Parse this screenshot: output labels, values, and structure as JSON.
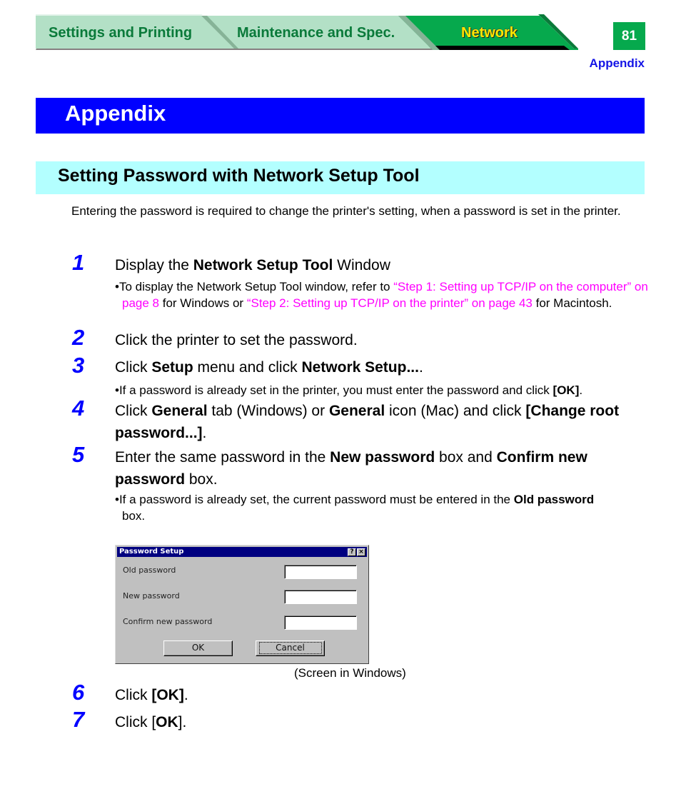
{
  "nav": {
    "tabs": [
      {
        "label": "Settings and Printing",
        "active": false
      },
      {
        "label": "Maintenance and Spec.",
        "active": false
      },
      {
        "label": "Network",
        "active": true
      }
    ],
    "page_number": "81",
    "section": "Appendix"
  },
  "colors": {
    "chapter_banner": "#0000ff",
    "section_banner": "#b3ffff",
    "tab_inactive": "#b3e0c6",
    "tab_active": "#06a94d",
    "tab_text": "#0a7a3a",
    "active_tab_text": "#ffe800",
    "step_number": "#0000ff",
    "link": "#ff00ff"
  },
  "chapter_title": "Appendix",
  "section_title": "Setting Password with Network Setup Tool",
  "intro": "Entering the password is required to change the printer's setting, when a password is set in the printer.",
  "steps": {
    "s1": {
      "num": "1",
      "t1": "Display the ",
      "b1": "Network Setup Tool",
      "t2": " Window",
      "bullet": {
        "t1": "To display the Network Setup Tool window, refer to ",
        "link1": "“Step 1: Setting up TCP/IP on the computer” on page 8",
        "t2": " for Windows or ",
        "link2": "“Step 2: Setting up TCP/IP on the printer” on page 43",
        "t3": " for Macintosh."
      }
    },
    "s2": {
      "num": "2",
      "text": "Click the printer to set the password."
    },
    "s3": {
      "num": "3",
      "t1": "Click ",
      "b1": "Setup",
      "t2": " menu and click ",
      "b2": "Network Setup...",
      "t3": ".",
      "bullet": {
        "t1": "If a password is already set in the printer, you must enter the password and click ",
        "b1": "[OK]",
        "t2": "."
      }
    },
    "s4": {
      "num": "4",
      "t1": "Click ",
      "b1": "General",
      "t2": " tab (Windows) or ",
      "b2": "General",
      "t3": " icon (Mac) and click ",
      "b3": "[Change root password...]",
      "t4": "."
    },
    "s5": {
      "num": "5",
      "t1": "Enter the same password in the ",
      "b1": "New password",
      "t2": " box and ",
      "b2": "Confirm new password",
      "t3": " box.",
      "bullet": {
        "t1": "If a password is already set, the current password must be entered in the ",
        "b1": "Old password",
        "t2": " box."
      }
    },
    "s6": {
      "num": "6",
      "t1": "Click ",
      "b1": "[OK]",
      "t2": "."
    },
    "s7": {
      "num": "7",
      "t1": "Click [",
      "b1": "OK",
      "t2": "]."
    }
  },
  "dialog": {
    "title": "Password Setup",
    "help_glyph": "?",
    "close_glyph": "×",
    "fields": [
      {
        "label": "Old password",
        "value": ""
      },
      {
        "label": "New password",
        "value": ""
      },
      {
        "label": "Confirm new password",
        "value": ""
      }
    ],
    "ok_label": "OK",
    "cancel_label": "Cancel"
  },
  "caption": "(Screen in Windows)"
}
